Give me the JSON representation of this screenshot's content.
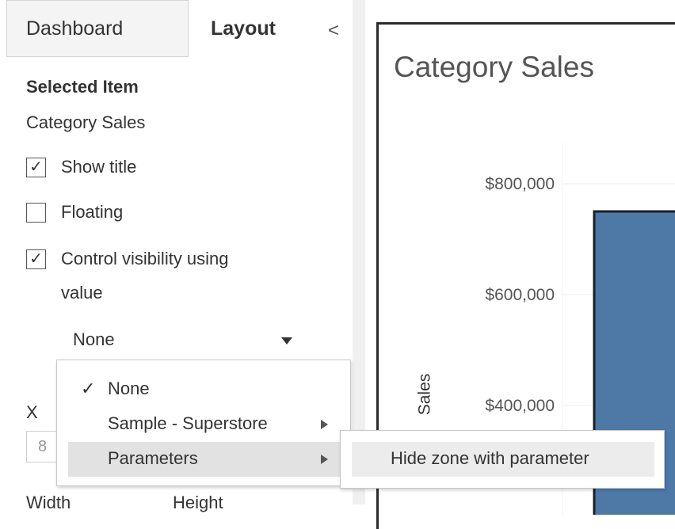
{
  "tabs": {
    "dashboard": "Dashboard",
    "layout": "Layout",
    "collapse": "<"
  },
  "selected_item": {
    "heading": "Selected Item",
    "name": "Category Sales",
    "show_title": {
      "label": "Show title",
      "checked": true
    },
    "floating": {
      "label": "Floating",
      "checked": false
    },
    "control_visibility": {
      "label_line1": "Control visibility using",
      "label_line2": "value",
      "checked": true
    },
    "visibility_value": "None"
  },
  "position": {
    "x_label": "X",
    "x_value": "8",
    "width_label": "Width",
    "height_label": "Height"
  },
  "menu": {
    "items": [
      {
        "label": "None",
        "checked": true,
        "has_submenu": false
      },
      {
        "label": "Sample - Superstore",
        "checked": false,
        "has_submenu": true
      },
      {
        "label": "Parameters",
        "checked": false,
        "has_submenu": true,
        "highlighted": true
      }
    ],
    "check_glyph": "✓",
    "submenu": {
      "items": [
        {
          "label": "Hide zone with parameter"
        }
      ]
    }
  },
  "sheet": {
    "title": "Category Sales",
    "bar_color": "#4e79a7"
  },
  "chart_data": {
    "type": "bar",
    "title": "Category Sales",
    "ylabel": "Sales",
    "ytick_labels": [
      "$800,000",
      "$600,000",
      "$400,000"
    ],
    "yticks": [
      800000,
      600000,
      400000
    ],
    "ylim": [
      0,
      900000
    ],
    "categories": [
      ""
    ],
    "values": [
      750000
    ]
  }
}
